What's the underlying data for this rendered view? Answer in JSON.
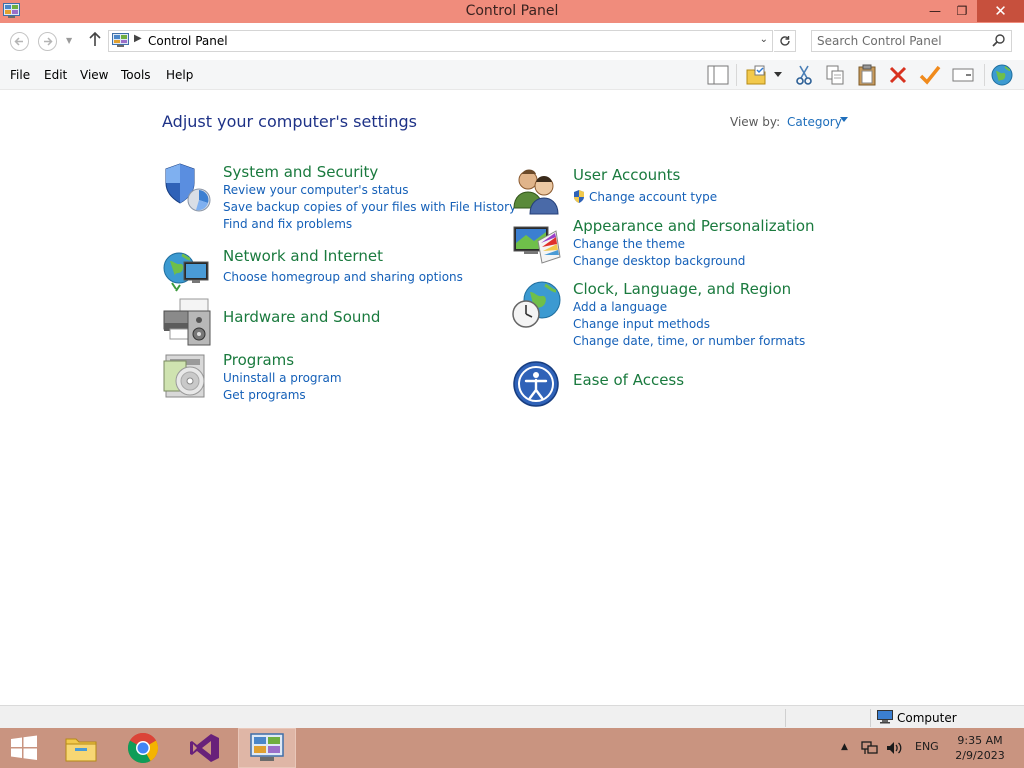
{
  "window": {
    "title": "Control Panel",
    "minimize": "—",
    "maximize": "❐",
    "close": "✕"
  },
  "address": {
    "breadcrumb": "Control Panel",
    "search_placeholder": "Search Control Panel"
  },
  "menu": [
    "File",
    "Edit",
    "View",
    "Tools",
    "Help"
  ],
  "toolbar_icons": [
    "layout-icon",
    "folder-properties-icon",
    "cut-icon",
    "copy-icon",
    "paste-icon",
    "delete-icon",
    "checkmark-icon",
    "rename-icon",
    "globe-icon"
  ],
  "content": {
    "heading": "Adjust your computer's settings",
    "view_by_label": "View by:",
    "view_by_value": "Category"
  },
  "categories": {
    "left": [
      {
        "title": "System and Security",
        "links": [
          "Review your computer's status",
          "Save backup copies of your files with File History",
          "Find and fix problems"
        ],
        "icon": "shield-icon"
      },
      {
        "title": "Network and Internet",
        "links": [
          "Choose homegroup and sharing options"
        ],
        "icon": "network-globe-icon"
      },
      {
        "title": "Hardware and Sound",
        "links": [],
        "icon": "printer-icon"
      },
      {
        "title": "Programs",
        "links": [
          "Uninstall a program",
          "Get programs"
        ],
        "icon": "programs-icon"
      }
    ],
    "right": [
      {
        "title": "User Accounts",
        "links": [
          "Change account type"
        ],
        "icon": "users-icon"
      },
      {
        "title": "Appearance and Personalization",
        "links": [
          "Change the theme",
          "Change desktop background"
        ],
        "icon": "monitor-palette-icon"
      },
      {
        "title": "Clock, Language, and Region",
        "links": [
          "Add a language",
          "Change input methods",
          "Change date, time, or number formats"
        ],
        "icon": "clock-globe-icon"
      },
      {
        "title": "Ease of Access",
        "links": [],
        "icon": "ease-of-access-icon"
      }
    ]
  },
  "statusbar": {
    "location": "Computer"
  },
  "taskbar": {
    "apps": [
      "windows-start-icon",
      "file-explorer-icon",
      "chrome-icon",
      "visual-studio-icon",
      "control-panel-icon"
    ],
    "tray_caret": "▲",
    "language": "ENG",
    "time": "9:35 AM",
    "date": "2/9/2023"
  }
}
